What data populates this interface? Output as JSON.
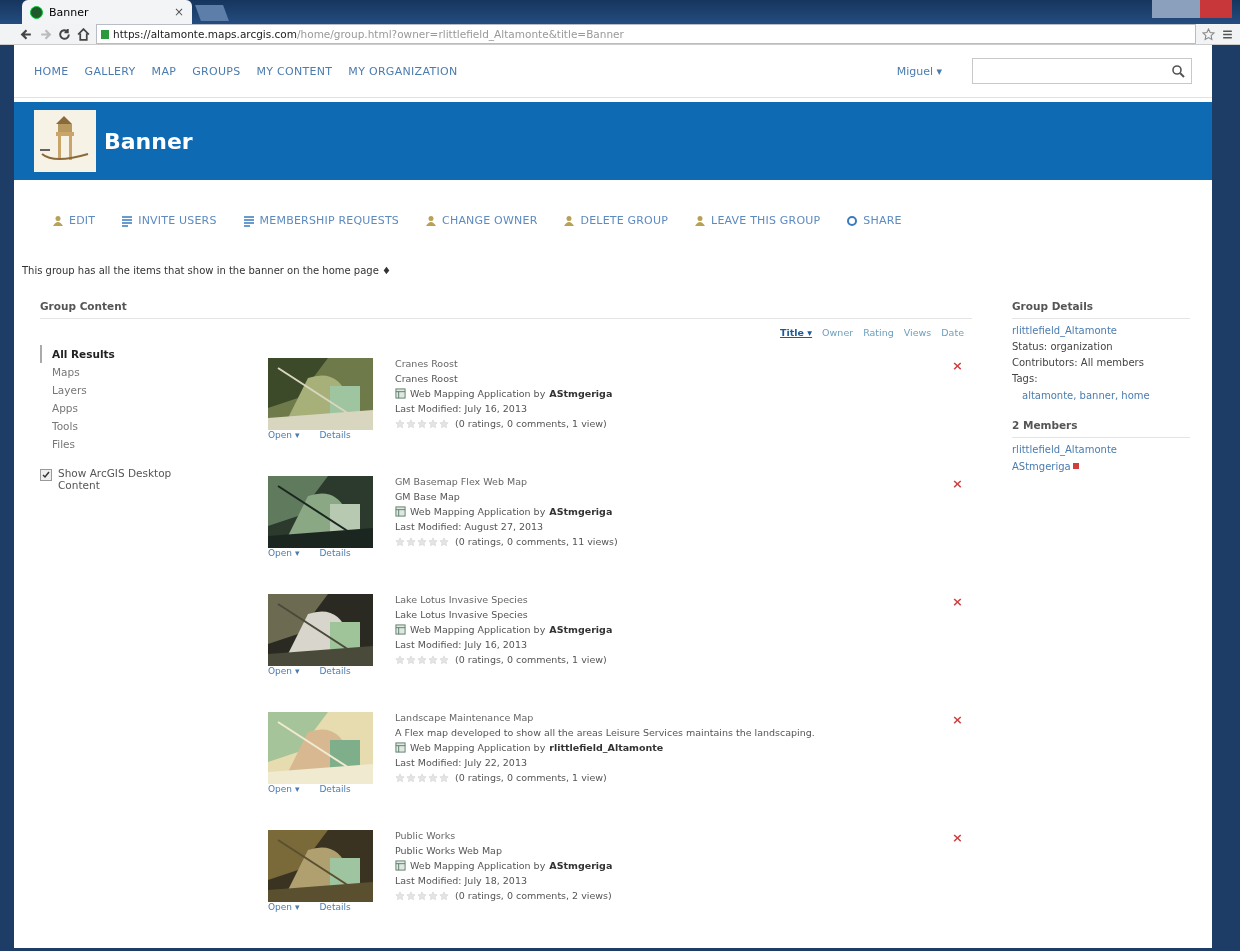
{
  "browser": {
    "tab_title": "Banner",
    "tab_close": "×",
    "url_host": "https://altamonte.maps.arcgis.com",
    "url_path": "/home/group.html?owner=rlittlefield_Altamonte&title=Banner"
  },
  "nav": {
    "items": [
      "HOME",
      "GALLERY",
      "MAP",
      "GROUPS",
      "MY CONTENT",
      "MY ORGANIZATION"
    ],
    "user": "Miguel ▾"
  },
  "banner": {
    "title": "Banner"
  },
  "actions": [
    "EDIT",
    "INVITE USERS",
    "MEMBERSHIP REQUESTS",
    "CHANGE OWNER",
    "DELETE GROUP",
    "LEAVE THIS GROUP",
    "SHARE"
  ],
  "description": "This group has all the items that show in the banner on the home page",
  "description_marker": "♦",
  "group_content": {
    "heading": "Group Content",
    "filters": [
      {
        "label": "All Results",
        "selected": true
      },
      {
        "label": "Maps",
        "selected": false
      },
      {
        "label": "Layers",
        "selected": false
      },
      {
        "label": "Apps",
        "selected": false
      },
      {
        "label": "Tools",
        "selected": false
      },
      {
        "label": "Files",
        "selected": false
      }
    ],
    "desktop_content": {
      "label": "Show ArcGIS Desktop Content",
      "checked": true
    },
    "sort": [
      {
        "label": "Title ▾",
        "selected": true
      },
      {
        "label": "Owner",
        "selected": false
      },
      {
        "label": "Rating",
        "selected": false
      },
      {
        "label": "Views",
        "selected": false
      },
      {
        "label": "Date",
        "selected": false
      }
    ],
    "items": [
      {
        "title": "Cranes Roost",
        "snippet": "Cranes Roost",
        "type": "Web Mapping Application by",
        "owner": "AStmgeriga",
        "modified": "Last Modified: July 16, 2013",
        "stars": 0,
        "stats": "(0 ratings, 0 comments, 1 view)",
        "open": "Open ▾",
        "details": "Details",
        "remove": "×"
      },
      {
        "title": "GM Basemap Flex Web Map",
        "snippet": "GM Base Map",
        "type": "Web Mapping Application by",
        "owner": "AStmgeriga",
        "modified": "Last Modified: August 27, 2013",
        "stars": 0,
        "stats": "(0 ratings, 0 comments, 11 views)",
        "open": "Open ▾",
        "details": "Details",
        "remove": "×"
      },
      {
        "title": "Lake Lotus Invasive Species",
        "snippet": "Lake Lotus Invasive Species",
        "type": "Web Mapping Application by",
        "owner": "AStmgeriga",
        "modified": "Last Modified: July 16, 2013",
        "stars": 0,
        "stats": "(0 ratings, 0 comments, 1 view)",
        "open": "Open ▾",
        "details": "Details",
        "remove": "×"
      },
      {
        "title": "Landscape Maintenance Map",
        "snippet": "A Flex map developed to show all the areas Leisure Services maintains the landscaping.",
        "type": "Web Mapping Application by",
        "owner": "rlittlefield_Altamonte",
        "modified": "Last Modified: July 22, 2013",
        "stars": 0,
        "stats": "(0 ratings, 0 comments, 1 view)",
        "open": "Open ▾",
        "details": "Details",
        "remove": "×"
      },
      {
        "title": "Public Works",
        "snippet": "Public Works Web Map",
        "type": "Web Mapping Application by",
        "owner": "AStmgeriga",
        "modified": "Last Modified: July 18, 2013",
        "stars": 0,
        "stats": "(0 ratings, 0 comments, 2 views)",
        "open": "Open ▾",
        "details": "Details",
        "remove": "×"
      }
    ]
  },
  "group_details": {
    "heading": "Group Details",
    "owner": "rlittlefield_Altamonte",
    "status": "Status: organization",
    "contributors": "Contributors: All members",
    "tags_label": "Tags:",
    "tags": "altamonte, banner, home",
    "members_heading": "2 Members",
    "members": [
      {
        "name": "rlittlefield_Altamonte",
        "removable": false
      },
      {
        "name": "AStmgeriga",
        "removable": true
      }
    ]
  }
}
